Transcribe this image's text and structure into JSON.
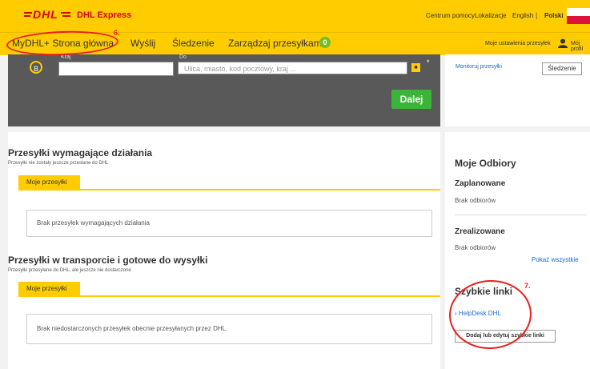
{
  "header": {
    "brand": "DHL Express",
    "links": [
      "Centrum pomocy",
      "Lokalizacje",
      "English",
      "Polski"
    ],
    "separator": "|"
  },
  "nav": {
    "items": [
      "MyDHL+ Strona główna",
      "Wyślij",
      "Śledzenie",
      "Zarządzaj przesyłkami"
    ],
    "manage_count": "0",
    "settings": "Moje ustawienia przesyłek",
    "profile": "Mój profil"
  },
  "form": {
    "badge": "B",
    "country_label": "Kraj",
    "address_label": "Do",
    "address_placeholder": "Ulica, miasto, kod pocztowy, kraj ...",
    "addr_book_icon": "address-book-icon",
    "asterisk": "*",
    "next_button": "Dalej"
  },
  "tracking": {
    "monitor_link": "Monitoruj przesyłki",
    "track_button": "Śledzenie"
  },
  "section1": {
    "title": "Przesyłki wymagające działania",
    "subtitle": "Przesyłki nie zostały jeszcze przesłane do DHL",
    "tab": "Moje przesyłki",
    "empty": "Brak przesyłek wymagających działania"
  },
  "section2": {
    "title": "Przesyłki w transporcie i gotowe do wysyłki",
    "subtitle": "Przesyłki przesyłane do DHL, ale jeszcze nie dostarczone",
    "tab": "Moje przesyłki",
    "empty": "Brak niedostarczonych przesyłek obecnie przesyłanych przez DHL"
  },
  "pickups": {
    "title": "Moje Odbiory",
    "planned_title": "Zaplanowane",
    "planned_text": "Brak odbiorów",
    "done_title": "Zrealizowane",
    "done_text": "Brak odbiorów",
    "show_all": "Pokaż wszystkie"
  },
  "quick_links": {
    "title": "Szybkie linki",
    "items": [
      "HelpDesk DHL"
    ],
    "edit_button": "Dodaj lub edytuj szybkie linki"
  },
  "annotations": {
    "mark_nav": "6.",
    "mark_links": "7.",
    "color": "#e8211d"
  },
  "colors": {
    "dhl_yellow": "#ffcc00",
    "dhl_red": "#d40511",
    "button_green": "#3bb539",
    "link_blue": "#1a6ac7"
  }
}
